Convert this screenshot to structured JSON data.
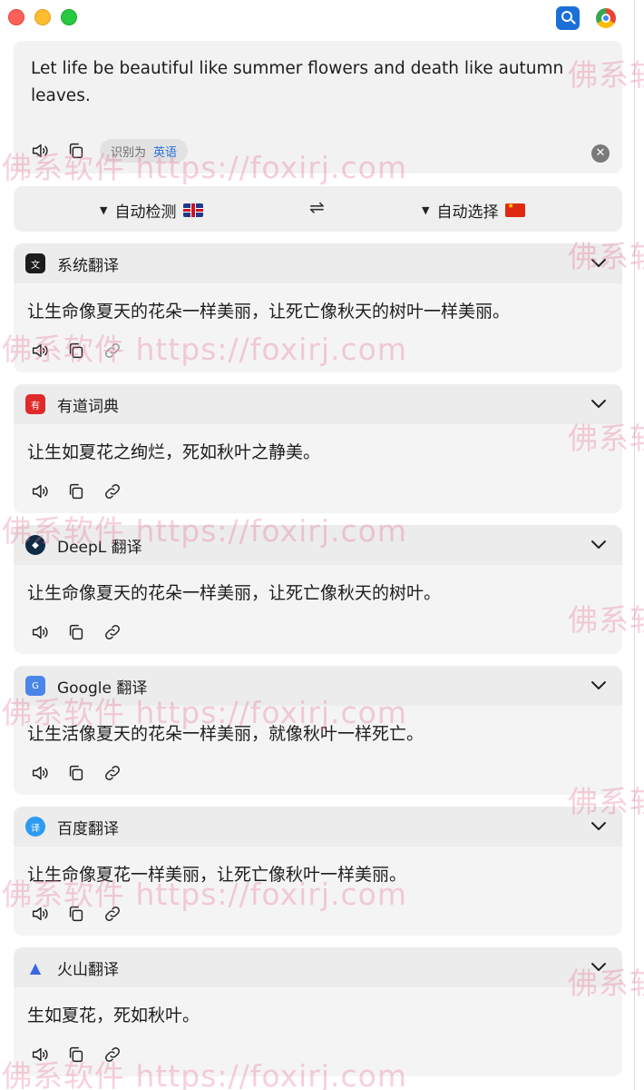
{
  "colors": {
    "close": "#fe5f57",
    "minimize": "#febc2e",
    "zoom": "#28c840",
    "accent_blue": "#2a6fdb",
    "card_bg": "#f4f4f4"
  },
  "titlebar": {
    "app_icon": "translator-magnifier-icon",
    "browser_icon": "chrome-icon"
  },
  "source": {
    "text": "Let life be beautiful like summer flowers and death like autumn leaves.",
    "detected_prefix": "识别为",
    "detected_language": "英语",
    "clear_symbol": "✕"
  },
  "language_bar": {
    "source_label": "自动检测",
    "source_flag": "🇬🇧",
    "target_label": "自动选择",
    "target_flag": "🇨🇳",
    "swap_symbol": "⇌"
  },
  "results": [
    {
      "service": "系统翻译",
      "icon": "system-translate-icon",
      "text": "让生命像夏天的花朵一样美丽，让死亡像秋天的树叶一样美丽。"
    },
    {
      "service": "有道词典",
      "icon": "youdao-icon",
      "text": "让生如夏花之绚烂，死如秋叶之静美。"
    },
    {
      "service": "DeepL 翻译",
      "icon": "deepl-icon",
      "text": "让生命像夏天的花朵一样美丽，让死亡像秋天的树叶。"
    },
    {
      "service": "Google 翻译",
      "icon": "google-translate-icon",
      "text": "让生活像夏天的花朵一样美丽，就像秋叶一样死亡。"
    },
    {
      "service": "百度翻译",
      "icon": "baidu-translate-icon",
      "text": "让生命像夏花一样美丽，让死亡像秋叶一样美丽。"
    },
    {
      "service": "火山翻译",
      "icon": "volcano-translate-icon",
      "text": "生如夏花，死如秋叶。"
    }
  ],
  "watermark": {
    "text": "佛系软件 https://foxirj.com",
    "short": "佛系软"
  }
}
